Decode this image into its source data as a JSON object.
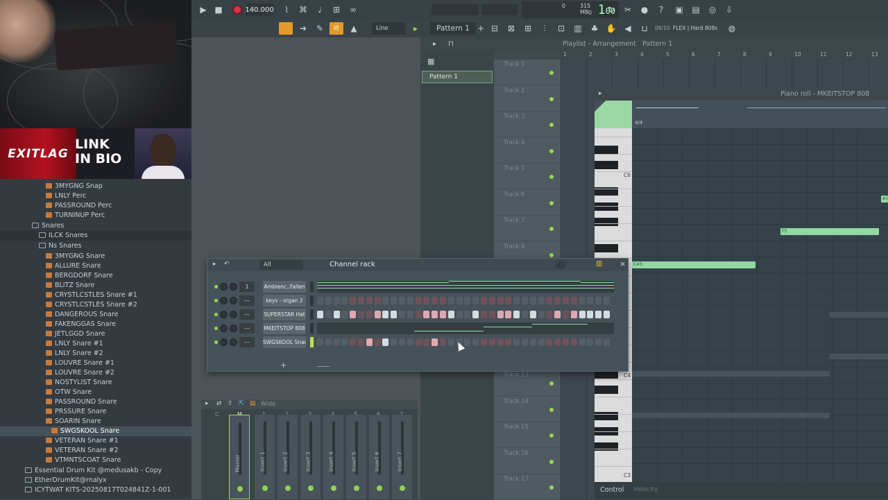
{
  "overlay": {
    "sponsor": "EXITLAG",
    "link_line1": "LINK",
    "link_line2": "IN BIO"
  },
  "browser": {
    "items": [
      {
        "label": "3MYGNG Snap",
        "type": "file",
        "indent": 1
      },
      {
        "label": "LNLY Perc",
        "type": "file",
        "indent": 1
      },
      {
        "label": "PASSROUND Perc",
        "type": "file",
        "indent": 1
      },
      {
        "label": "TURNINUP Perc",
        "type": "file",
        "indent": 1
      },
      {
        "label": "Snares",
        "type": "folder",
        "indent": 0
      },
      {
        "label": "ILCK Snares",
        "type": "folder",
        "indent": 0
      },
      {
        "label": "Ns Snares",
        "type": "folder",
        "indent": 0
      },
      {
        "label": "3MYGNG Snare",
        "type": "file",
        "indent": 1
      },
      {
        "label": "ALLURE Snare",
        "type": "file",
        "indent": 1
      },
      {
        "label": "BERGDORF Snare",
        "type": "file",
        "indent": 1
      },
      {
        "label": "BLITZ Snare",
        "type": "file",
        "indent": 1
      },
      {
        "label": "CRYSTLCSTLES Snare #1",
        "type": "file",
        "indent": 1
      },
      {
        "label": "CRYSTLCSTLES Snare #2",
        "type": "file",
        "indent": 1
      },
      {
        "label": "DANGEROUS Snare",
        "type": "file",
        "indent": 1
      },
      {
        "label": "FAKENGGAS Snare",
        "type": "file",
        "indent": 1
      },
      {
        "label": "JETLGGD Snare",
        "type": "file",
        "indent": 1
      },
      {
        "label": "LNLY Snare #1",
        "type": "file",
        "indent": 1
      },
      {
        "label": "LNLY Snare #2",
        "type": "file",
        "indent": 1
      },
      {
        "label": "LOUVRE Snare #1",
        "type": "file",
        "indent": 1
      },
      {
        "label": "LOUVRE Snare #2",
        "type": "file",
        "indent": 1
      },
      {
        "label": "NOSTYLIST Snare",
        "type": "file",
        "indent": 1
      },
      {
        "label": "OTW Snare",
        "type": "file",
        "indent": 1
      },
      {
        "label": "PASSROUND Snare",
        "type": "file",
        "indent": 1
      },
      {
        "label": "PRSSURE Snare",
        "type": "file",
        "indent": 1
      },
      {
        "label": "SOARIN Snare",
        "type": "file",
        "indent": 1
      },
      {
        "label": "SWGSKOOL Snare",
        "type": "file",
        "indent": 1,
        "selected": true
      },
      {
        "label": "VETERAN Snare #1",
        "type": "file",
        "indent": 1
      },
      {
        "label": "VETERAN Snare #2",
        "type": "file",
        "indent": 1
      },
      {
        "label": "VTMNTSCOAT Snare",
        "type": "file",
        "indent": 1
      },
      {
        "label": "Essential Drum Kit @medusakb - Copy",
        "type": "folder",
        "indent": 0
      },
      {
        "label": "EtherDrumKit@rnalyx",
        "type": "folder",
        "indent": 0
      },
      {
        "label": "ICYTWAT KITS-20250817T024841Z-1-001",
        "type": "folder",
        "indent": 0
      }
    ]
  },
  "transport": {
    "tempo": "140.000",
    "time": "1:01",
    "time_sub": "00",
    "cpu": "315 MB",
    "cpu_zero": "0",
    "cpu_zero2": "0"
  },
  "toolbar2": {
    "snap": "Line",
    "pattern": "Pattern 1",
    "hint_prefix": "08/10",
    "hint": "FLEX | Hard 808s"
  },
  "playlist": {
    "title": "Playlist - Arrangement",
    "pattern": "Pattern 1",
    "ruler": [
      "1",
      "2",
      "3",
      "4",
      "5",
      "6",
      "7",
      "8",
      "9",
      "10",
      "11",
      "12",
      "13"
    ],
    "pattern_block": "Pattern 1",
    "tracks": [
      "Track 1",
      "Track 2",
      "Track 3",
      "Track 4",
      "Track 5",
      "Track 6",
      "Track 7",
      "Track 8",
      "Track 13",
      "Track 14",
      "Track 15",
      "Track 16",
      "Track 17"
    ]
  },
  "piano_roll": {
    "title": "Piano roll - MKEITSTOP 808",
    "time_sig": "4/4",
    "keys": [
      "C6",
      "C4",
      "C3"
    ],
    "notes": [
      "A5",
      "F5",
      "C#5"
    ],
    "control": "Control",
    "velocity": "Velocity"
  },
  "channel_rack": {
    "filter": "All",
    "title": "Channel rack",
    "channels": [
      {
        "num": "1",
        "name": "Ambienc..Fallen",
        "type": "mini"
      },
      {
        "num": "---",
        "name": "keys - organ 2",
        "type": "steps",
        "on": []
      },
      {
        "num": "---",
        "name": "SUPERSTAR Hat",
        "type": "steps",
        "on": [
          0,
          2,
          4,
          7,
          8,
          9,
          13,
          14,
          15,
          16,
          19,
          22,
          23,
          24,
          26,
          29,
          31,
          32,
          33,
          34,
          35,
          37,
          38,
          40
        ]
      },
      {
        "num": "---",
        "name": "MKEITSTOP 808",
        "type": "mini"
      },
      {
        "num": "---",
        "name": "SWGSKOOL Snare",
        "type": "steps",
        "on": [
          6,
          8,
          14
        ]
      }
    ]
  },
  "mixer": {
    "preset": "Wide",
    "strip_nums": [
      "C",
      "M",
      "1",
      "2",
      "3",
      "4",
      "5",
      "6",
      "7"
    ],
    "strips": [
      "Master",
      "Insert 1",
      "Insert 2",
      "Insert 3",
      "Insert 4",
      "Insert 5",
      "Insert 6",
      "Insert 7"
    ]
  },
  "colors": {
    "accent_green": "#8de29e",
    "lcd_green": "#a5ffb0",
    "note_green": "#92d8a3",
    "record_red": "#d8334a",
    "folder_orange": "#c87a3d"
  }
}
